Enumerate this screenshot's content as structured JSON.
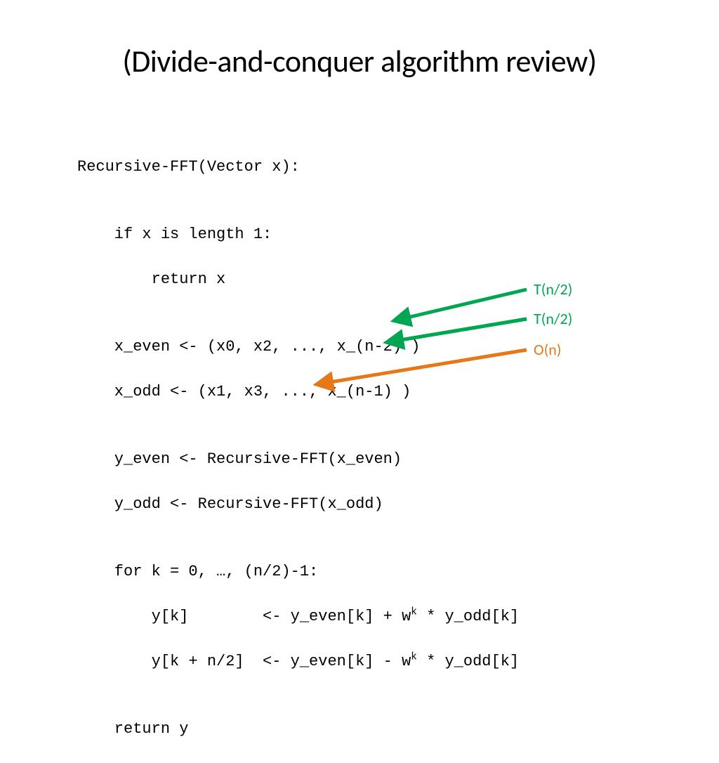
{
  "title": "(Divide-and-conquer algorithm review)",
  "code": {
    "l1": "Recursive-FFT(Vector x):",
    "l2": "",
    "l3": "    if x is length 1:",
    "l4": "        return x",
    "l5": "",
    "l6": "    x_even <- (x0, x2, ..., x_(n-2) )",
    "l7": "    x_odd <- (x1, x3, ..., x_(n-1) )",
    "l8": "",
    "l9": "    y_even <- Recursive-FFT(x_even)",
    "l10": "    y_odd <- Recursive-FFT(x_odd)",
    "l11": "",
    "l12": "    for k = 0, …, (n/2)-1:",
    "l13a": "        y[k]        <- y_even[k] + w",
    "l13b": " * y_odd[k]",
    "l14a": "        y[k + n/2]  <- y_even[k] - w",
    "l14b": " * y_odd[k]",
    "l15": "",
    "l16": "    return y",
    "sup": "k"
  },
  "annotations": {
    "a1": "T(n/2)",
    "a2": "T(n/2)",
    "a3": "O(n)"
  },
  "colors": {
    "green": "#00a651",
    "orange": "#e67817"
  }
}
